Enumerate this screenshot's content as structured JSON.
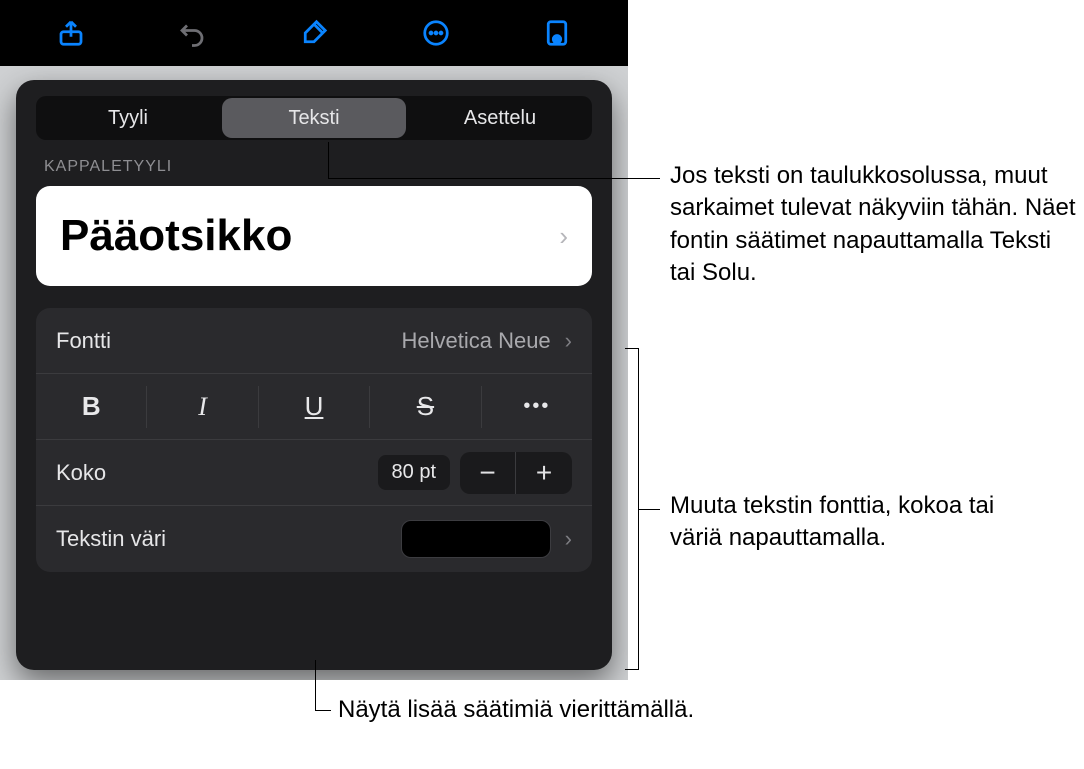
{
  "toolbar": {
    "icons": [
      "share-icon",
      "undo-icon",
      "format-brush-icon",
      "more-icon",
      "document-view-icon"
    ]
  },
  "tabs": {
    "style": "Tyyli",
    "text": "Teksti",
    "layout": "Asettelu"
  },
  "section": {
    "paragraphStyle": "KAPPALETYYLI"
  },
  "styleCard": {
    "name": "Pääotsikko"
  },
  "font": {
    "label": "Fontti",
    "value": "Helvetica Neue"
  },
  "format_buttons": {
    "bold": "B",
    "italic": "I",
    "underline": "U",
    "strike": "S",
    "more": "•••"
  },
  "size": {
    "label": "Koko",
    "value": "80 pt",
    "minus": "−",
    "plus": "+"
  },
  "textColor": {
    "label": "Tekstin väri",
    "swatch": "#000000"
  },
  "callouts": {
    "tabs": "Jos teksti on taulukkosolussa, muut sarkaimet tulevat näkyviin tähän. Näet fontin säätimet napauttamalla Teksti tai Solu.",
    "fontBlock": "Muuta tekstin fonttia, kokoa tai väriä napauttamalla.",
    "scroll": "Näytä lisää säätimiä vierittämällä."
  }
}
